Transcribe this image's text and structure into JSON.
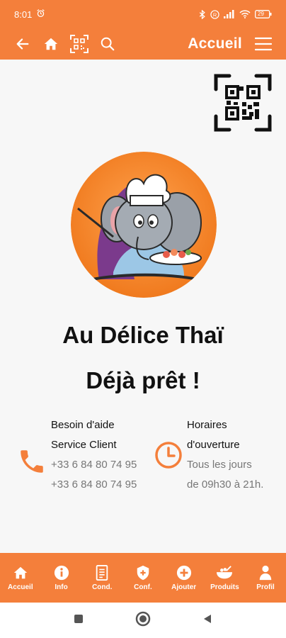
{
  "status_bar": {
    "time": "8:01",
    "battery": "29"
  },
  "app_bar": {
    "title": "Accueil"
  },
  "main": {
    "shop_name": "Au Délice Thaï",
    "shop_status": "Déjà prêt !",
    "help": {
      "title_line1": "Besoin d'aide",
      "title_line2": "Service Client",
      "phone1": "+33 6 84 80 74 95",
      "phone2": "+33 6 84 80 74 95"
    },
    "hours": {
      "title_line1": "Horaires",
      "title_line2": "d'ouverture",
      "line1": "Tous les jours",
      "line2": "de 09h30 à 21h."
    }
  },
  "bottom_nav": [
    {
      "label": "Accueil",
      "icon": "home-icon"
    },
    {
      "label": "Info",
      "icon": "info-icon"
    },
    {
      "label": "Cond.",
      "icon": "document-icon"
    },
    {
      "label": "Conf.",
      "icon": "shield-icon"
    },
    {
      "label": "Ajouter",
      "icon": "add-circle-icon"
    },
    {
      "label": "Produits",
      "icon": "bowl-icon"
    },
    {
      "label": "Profil",
      "icon": "person-icon"
    }
  ],
  "colors": {
    "accent": "#f47f3b",
    "background": "#f7f7f7",
    "text": "#111111",
    "muted": "#777777"
  }
}
